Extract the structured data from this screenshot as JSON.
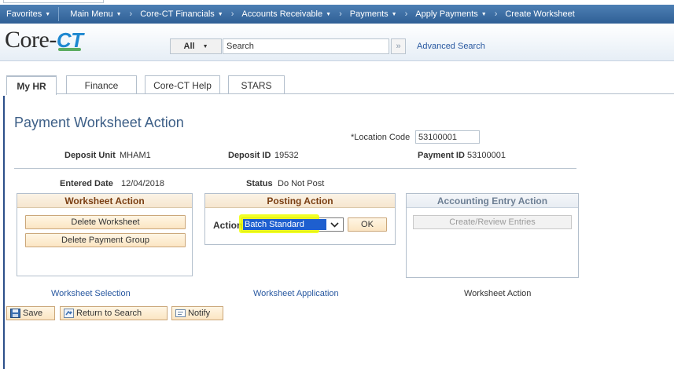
{
  "nav": {
    "favorites": "Favorites",
    "main_menu": "Main Menu",
    "breadcrumbs": [
      "Core-CT Financials",
      "Accounts Receivable",
      "Payments",
      "Apply Payments",
      "Create Worksheet"
    ]
  },
  "header": {
    "logo_text": "Core-",
    "logo_ct": "CT",
    "search_scope": "All",
    "search_placeholder": "Search",
    "advanced_search": "Advanced Search"
  },
  "tabs": [
    {
      "label": "My HR",
      "active": true
    },
    {
      "label": "Finance",
      "active": false
    },
    {
      "label": "Core-CT Help",
      "active": false
    },
    {
      "label": "STARS",
      "active": false
    }
  ],
  "page": {
    "title": "Payment Worksheet Action",
    "location_code_label": "*Location Code",
    "location_code_value": "53100001",
    "deposit_unit_label": "Deposit Unit",
    "deposit_unit_value": "MHAM1",
    "deposit_id_label": "Deposit ID",
    "deposit_id_value": "19532",
    "payment_id_label": "Payment ID",
    "payment_id_value": "53100001",
    "entered_date_label": "Entered Date",
    "entered_date_value": "12/04/2018",
    "status_label": "Status",
    "status_value": "Do Not Post"
  },
  "worksheet_action": {
    "title": "Worksheet Action",
    "delete_worksheet": "Delete Worksheet",
    "delete_payment_group": "Delete Payment Group"
  },
  "posting_action": {
    "title": "Posting Action",
    "action_label": "Action:",
    "action_value": "Batch Standard",
    "ok": "OK"
  },
  "accounting_entry_action": {
    "title": "Accounting Entry Action",
    "create_review": "Create/Review Entries"
  },
  "bottom_links": {
    "worksheet_selection": "Worksheet Selection",
    "worksheet_application": "Worksheet Application",
    "worksheet_action": "Worksheet Action"
  },
  "toolbar": {
    "save": "Save",
    "return_to_search": "Return to Search",
    "notify": "Notify"
  },
  "colors": {
    "nav_bar": "#3e6fa5",
    "title": "#3d5f87",
    "panel_head_text": "#7a3e12",
    "link": "#2858a0",
    "highlight": "#eeff00",
    "select_fill": "#1e5fcf"
  }
}
